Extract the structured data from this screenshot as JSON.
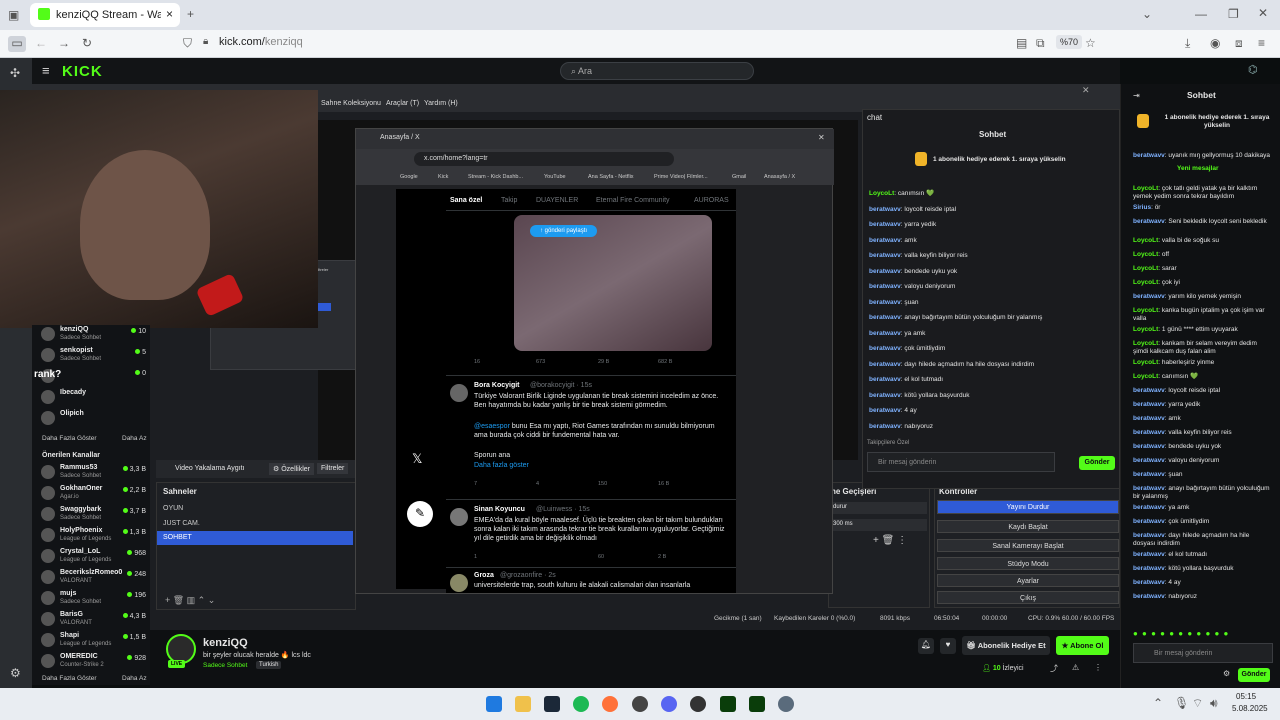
{
  "browser": {
    "tab_title": "kenziQQ Stream - Watch Live o",
    "url_host": "kick.com/",
    "url_path": "kenziqq",
    "zoom": "%70"
  },
  "kick": {
    "logo": "KICK",
    "search_placeholder": "Ara"
  },
  "obs": {
    "menu": [
      "Sahne Koleksiyonu",
      "Araçlar (T)",
      "Yardım (H)"
    ],
    "source_label": "Video Yakalama Aygıtı",
    "props": "Özellikler",
    "filters": "Filtreler",
    "scenes_title": "Sahneler",
    "scenes": [
      "OYUN",
      "JUST CAM.",
      "SOHBET"
    ],
    "transitions": "ne Geçişleri",
    "transition_value": "durur",
    "duration": "300 ms",
    "controls_title": "Kontroller",
    "controls": [
      "Yayını Durdur",
      "Kaydı Başlat",
      "Sanal Kamerayı Başlat",
      "Stüdyo Modu",
      "Ayarlar",
      "Çıkış"
    ],
    "status": {
      "drop": "Gecikme (1 san)",
      "frames": "Kaybedilen Kareler 0 (%0.0)",
      "kbps": "8091 kbps",
      "time1": "06:50:04",
      "time2": "00:00:00",
      "cpu": "CPU: 0.9%",
      "fps": "60.00 / 60.00 FPS"
    },
    "nested_scenes": [
      "OYUN",
      "JUST CAM.",
      "SOHBET"
    ],
    "nested_title": "Video Yakalama Aygıtı",
    "nested_props": "Özellikler",
    "nested_filters": "Filtreler"
  },
  "x_window": {
    "tab": "Anasayfa / X",
    "url": "x.com/home?lang=tr",
    "bookmarks": [
      "Google",
      "Kick",
      "Stream - Kick Dashb...",
      "YouTube",
      "Ana Sayfa - Netflix",
      "Prime Video| Filmler...",
      "Gmail",
      "Anasayfa / X"
    ],
    "tabs": [
      "Sana özel",
      "Takip",
      "DUAYENLER",
      "Eternal Fire Community",
      "AURORAS"
    ],
    "pill": "gönderi paylaştı",
    "stats1": [
      "16",
      "673",
      "29 B",
      "682 B"
    ],
    "tweet1": {
      "name": "Bora Kocyigit",
      "handle": "@borakocyigit · 15s",
      "text": "Türkiye Valorant Birlik Liginde uygulanan tie break sistemini inceledim az önce. Ben hayatımda bu kadar yanlış bir tie break sistemi görmedim.",
      "text2_mention": "@esaespor",
      "text2": "bunu Esa mı yaptı, Riot Games tarafından mı sunuldu bilmiyorum ama burada çok ciddi bir fundemental hata var.",
      "text3": "Sporun ana",
      "more": "Daha fazla göster",
      "stats": [
        "7",
        "4",
        "150",
        "16 B"
      ]
    },
    "tweet2": {
      "name": "Sinan Koyuncu",
      "handle": "@Luinwess · 15s",
      "text": "EMEA'da da kural böyle maalesef. Üçlü tie breakten çıkan bir takım bulundukları sonra kalan iki takım arasında tekrar tie break kurallarını uyguluyorlar. Geçtiğimiz yıl dile getirdik ama bir değişiklik olmadı",
      "stats": [
        "1",
        "",
        "60",
        "2 B"
      ]
    },
    "tweet3": {
      "name": "Groza",
      "handle": "@grozaonfire · 2s",
      "text": "universitelerde trap, south kulturu ile alakali calismalari olan insanlarla"
    }
  },
  "obs_chat": {
    "title": "chat",
    "header": "Sohbet",
    "gift": "1 abonelik hediye ederek 1. sıraya yükselin",
    "messages": [
      [
        "LoycoLt",
        "canımsın 💚"
      ],
      [
        "beratwavv",
        "loycolt reisde iptal"
      ],
      [
        "beratwavv",
        "yarra yedik"
      ],
      [
        "beratwavv",
        "amk"
      ],
      [
        "beratwavv",
        "valla keyfin biliyor reis"
      ],
      [
        "beratwavv",
        "bendede uyku yok"
      ],
      [
        "beratwavv",
        "valoyu deniyorum"
      ],
      [
        "beratwavv",
        "şuan"
      ],
      [
        "beratwavv",
        "anayı bağırtayım bütün yolculuğum bir yalanmış"
      ],
      [
        "beratwavv",
        "ya amk"
      ],
      [
        "beratwavv",
        "çok ümitliydim"
      ],
      [
        "beratwavv",
        "dayı hilede açmadım ha hile dosyası indirdim"
      ],
      [
        "beratwavv",
        "el kol tutmadı"
      ],
      [
        "beratwavv",
        "kötü yollara başvurduk"
      ],
      [
        "beratwavv",
        "4 ay"
      ],
      [
        "beratwavv",
        "nabıyoruz"
      ]
    ],
    "followers": "Takipçilere Özel",
    "placeholder": "Bir mesaj gönderin",
    "send": "Gönder"
  },
  "sidebar": {
    "top": [
      [
        "kenziQQ",
        "Sadece Sohbet",
        "10"
      ],
      [
        "senkopist",
        "Sadece Sohbet",
        "5"
      ],
      [
        "",
        "",
        "0"
      ],
      [
        "Ibecady",
        "",
        ""
      ],
      [
        "Olipich",
        "",
        ""
      ]
    ],
    "overlay": "rank?",
    "more1": "Daha Fazla Göster",
    "less1": "Daha Az",
    "recommended_title": "Önerilen Kanallar",
    "recommended": [
      [
        "Rammus53",
        "Sadece Sohbet",
        "3,3 B"
      ],
      [
        "GokhanOner",
        "Agar.io",
        "2,2 B"
      ],
      [
        "Swaggybark",
        "Sadece Sohbet",
        "3,7 B"
      ],
      [
        "HolyPhoenix",
        "League of Legends",
        "1,3 B"
      ],
      [
        "Crystal_LoL",
        "League of Legends",
        "968"
      ],
      [
        "BecerikslzRomeo0",
        "VALORANT",
        "248"
      ],
      [
        "mujs",
        "Sadece Sohbet",
        "196"
      ],
      [
        "BarisG",
        "VALORANT",
        "4,3 B"
      ],
      [
        "Shapi",
        "League of Legends",
        "1,5 B"
      ],
      [
        "OMEREDIC",
        "Counter-Strike 2",
        "928"
      ]
    ],
    "more2": "Daha Fazla Göster",
    "less2": "Daha Az"
  },
  "stream": {
    "name": "kenziQQ",
    "title": "bir şeyler olucak heralde 🔥 lcs ldc",
    "category": "Sadece Sohbet",
    "lang": "Turkish",
    "live": "LIVE",
    "gift_btn": "Abonelik Hediye Et",
    "sub_btn": "Abone Ol",
    "viewers_num": "10",
    "viewers_label": "İzleyici"
  },
  "chat": {
    "title": "Sohbet",
    "gift": "1 abonelik hediye ederek 1. sıraya yükselin",
    "new_msgs": "Yeni mesajlar",
    "messages": [
      [
        "beratwavv",
        "uyanık mıŋ gellyormuş 10 dakikaya"
      ],
      [
        "LoycoLt",
        "çok tatlı geldi yatak ya bir kalktım yemek yedim sonra tekrar bayıldım"
      ],
      [
        "Sirius",
        "ör"
      ],
      [
        "beratwavv",
        "Seni bekledik loycolt seni bekledik"
      ],
      [
        "LoycoLt",
        "valla bi de soğuk su"
      ],
      [
        "LoycoLt",
        "off"
      ],
      [
        "LoycoLt",
        "sarar"
      ],
      [
        "LoycoLt",
        "çok iyi"
      ],
      [
        "beratwavv",
        "yarım kilo yemek yemişin"
      ],
      [
        "LoycoLt",
        "kanka bugün iptalim ya çok işim var valla"
      ],
      [
        "LoycoLt",
        "1 günü **** ettim uyuyarak"
      ],
      [
        "LoycoLt",
        "kankam bir selam vereyim dedim şimdi kalkcam duş falan alim"
      ],
      [
        "LoycoLt",
        "haberleşiriz yinme"
      ],
      [
        "LoycoLt",
        "canımsın 💚"
      ],
      [
        "beratwavv",
        "loycolt reisde iptal"
      ],
      [
        "beratwavv",
        "yarra yedik"
      ],
      [
        "beratwavv",
        "amk"
      ],
      [
        "beratwavv",
        "valla keyfin biliyor reis"
      ],
      [
        "beratwavv",
        "bendede uyku yok"
      ],
      [
        "beratwavv",
        "valoyu deniyorum"
      ],
      [
        "beratwavv",
        "şuan"
      ],
      [
        "beratwavv",
        "anayı bağırtayım bütün yolculuğum bir yalanmış"
      ],
      [
        "beratwavv",
        "ya amk"
      ],
      [
        "beratwavv",
        "çok ümitliydim"
      ],
      [
        "beratwavv",
        "dayı hilede açmadım ha hile dosyası indirdim"
      ],
      [
        "beratwavv",
        "el kol tutmadı"
      ],
      [
        "beratwavv",
        "kötü yollara başvurduk"
      ],
      [
        "beratwavv",
        "4 ay"
      ],
      [
        "beratwavv",
        "nabıyoruz"
      ]
    ],
    "placeholder": "Bir mesaj gönderin",
    "send": "Gönder"
  },
  "taskbar": {
    "time": "05:15",
    "date": "5.08.2025"
  },
  "colors": {
    "kick_green": "#53fc18",
    "obs_blue": "#2f5bd6"
  }
}
